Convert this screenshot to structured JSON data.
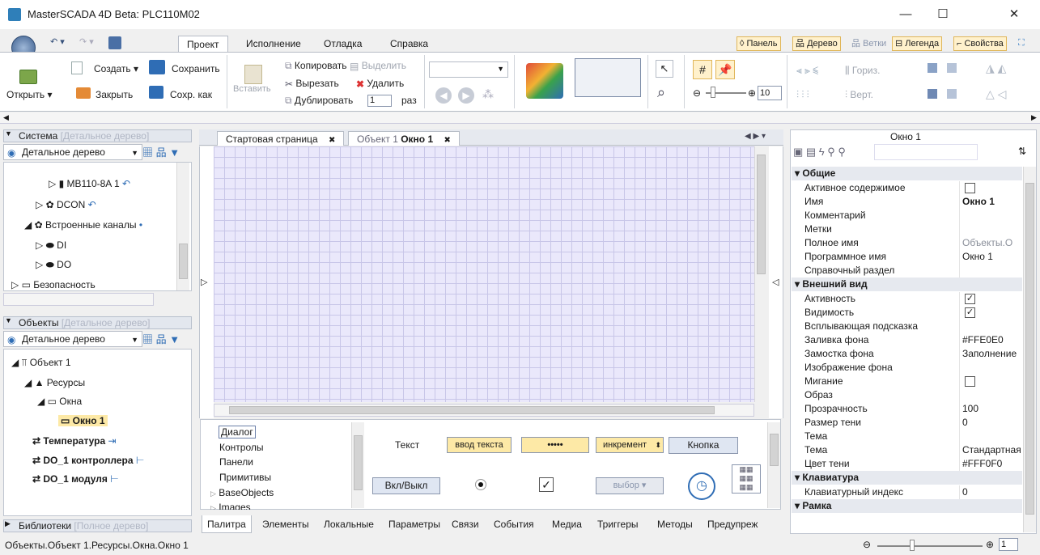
{
  "window": {
    "title": "MasterSCADA 4D Beta: PLC110M02",
    "minimize": "—",
    "maximize": "☐",
    "close": "✕"
  },
  "ribbon": {
    "tabs": [
      "Проект",
      "Исполнение",
      "Отладка",
      "Справка"
    ],
    "panel_toggles": [
      "Панель",
      "Дерево",
      "Ветки",
      "Легенда",
      "Свойства"
    ],
    "file": {
      "open": "Открыть",
      "create": "Создать",
      "close": "Закрыть",
      "save": "Сохранить",
      "save_as": "Сохр. как"
    },
    "edit": {
      "paste": "Вставить",
      "copy": "Копировать",
      "select": "Выделить",
      "cut": "Вырезать",
      "delete": "Удалить",
      "duplicate": "Дублировать",
      "duplicate_count": "1",
      "duplicate_unit": "раз"
    },
    "zoom_value": "10",
    "align": {
      "horizontal": "Гориз.",
      "vertical": "Верт."
    }
  },
  "system_panel": {
    "header": "Система",
    "header_hint": "[Детальное дерево]",
    "view": "Детальное дерево",
    "items": [
      {
        "label": "MB110-8A 1",
        "bold": false
      },
      {
        "label": "DCON",
        "bold": false
      },
      {
        "label": "Встроенные каналы",
        "bold": false
      },
      {
        "label": "DI",
        "bold": false
      },
      {
        "label": "DO",
        "bold": false
      },
      {
        "label": "Безопасность",
        "bold": false
      }
    ]
  },
  "objects_panel": {
    "header": "Объекты",
    "header_hint": "[Детальное дерево]",
    "view": "Детальное дерево",
    "items": [
      {
        "label": "Объект 1",
        "bold": false
      },
      {
        "label": "Ресурсы",
        "bold": false
      },
      {
        "label": "Окна",
        "bold": false
      },
      {
        "label": "Окно 1",
        "bold": true
      },
      {
        "label": "Температура",
        "bold": true
      },
      {
        "label": "DO_1 контроллера",
        "bold": true
      },
      {
        "label": "DO_1 модуля",
        "bold": true
      }
    ]
  },
  "libraries_panel": {
    "header": "Библиотеки",
    "header_hint": "[Полное дерево]"
  },
  "doc_tabs": [
    {
      "label": "Стартовая страница",
      "active": false
    },
    {
      "label_prefix": "Объект 1",
      "label": "Окно 1",
      "active": true
    }
  ],
  "palette": {
    "categories": [
      "Диалог",
      "Контролы",
      "Панели",
      "Примитивы",
      "BaseObjects",
      "Images"
    ],
    "controls": {
      "text": "Текст",
      "text_input": "ввод текста",
      "password": "•••••",
      "increment": "инкремент",
      "button": "Кнопка",
      "toggle": "Вкл/Выкл",
      "select": "выбор"
    }
  },
  "bottom_tabs": [
    "Палитра",
    "Элементы",
    "Локальные",
    "Параметры",
    "Связи",
    "События",
    "Медиа",
    "Триггеры",
    "Методы",
    "Предупреж"
  ],
  "properties": {
    "title": "Окно 1",
    "groups": [
      {
        "name": "Общие",
        "rows": [
          {
            "name": "Активное содержимое",
            "value": "",
            "check": "off"
          },
          {
            "name": "Имя",
            "value": "Окно 1",
            "bold": true
          },
          {
            "name": "Комментарий",
            "value": ""
          },
          {
            "name": "Метки",
            "value": ""
          },
          {
            "name": "Полное имя",
            "value": "Объекты.О",
            "muted": true
          },
          {
            "name": "Программное имя",
            "value": "Окно 1"
          },
          {
            "name": "Справочный раздел",
            "value": ""
          }
        ]
      },
      {
        "name": "Внешний вид",
        "rows": [
          {
            "name": "Активность",
            "value": "",
            "check": "on"
          },
          {
            "name": "Видимость",
            "value": "",
            "check": "on"
          },
          {
            "name": "Всплывающая подсказка",
            "value": ""
          },
          {
            "name": "Заливка фона",
            "value": "#FFE0E0"
          },
          {
            "name": "Замостка фона",
            "value": "Заполнение"
          },
          {
            "name": "Изображение фона",
            "value": ""
          },
          {
            "name": "Мигание",
            "value": "",
            "check": "off"
          },
          {
            "name": "Образ",
            "value": ""
          },
          {
            "name": "Прозрачность",
            "value": "100"
          },
          {
            "name": "Размер тени",
            "value": "0"
          },
          {
            "name": "Тема",
            "value": ""
          },
          {
            "name": "Тема",
            "value": "Стандартная"
          },
          {
            "name": "Цвет тени",
            "value": "#FFF0F0"
          }
        ]
      },
      {
        "name": "Клавиатура",
        "rows": [
          {
            "name": "Клавиатурный индекс",
            "value": "0"
          }
        ]
      },
      {
        "name": "Рамка",
        "rows": []
      }
    ]
  },
  "statusbar": {
    "path": "Объекты.Объект 1.Ресурсы.Окна.Окно 1",
    "zoom": "1"
  },
  "colors": {
    "accent": "#f5c542",
    "grid_bg": "#eae8fb",
    "panel_header": "#e3e7ee"
  }
}
